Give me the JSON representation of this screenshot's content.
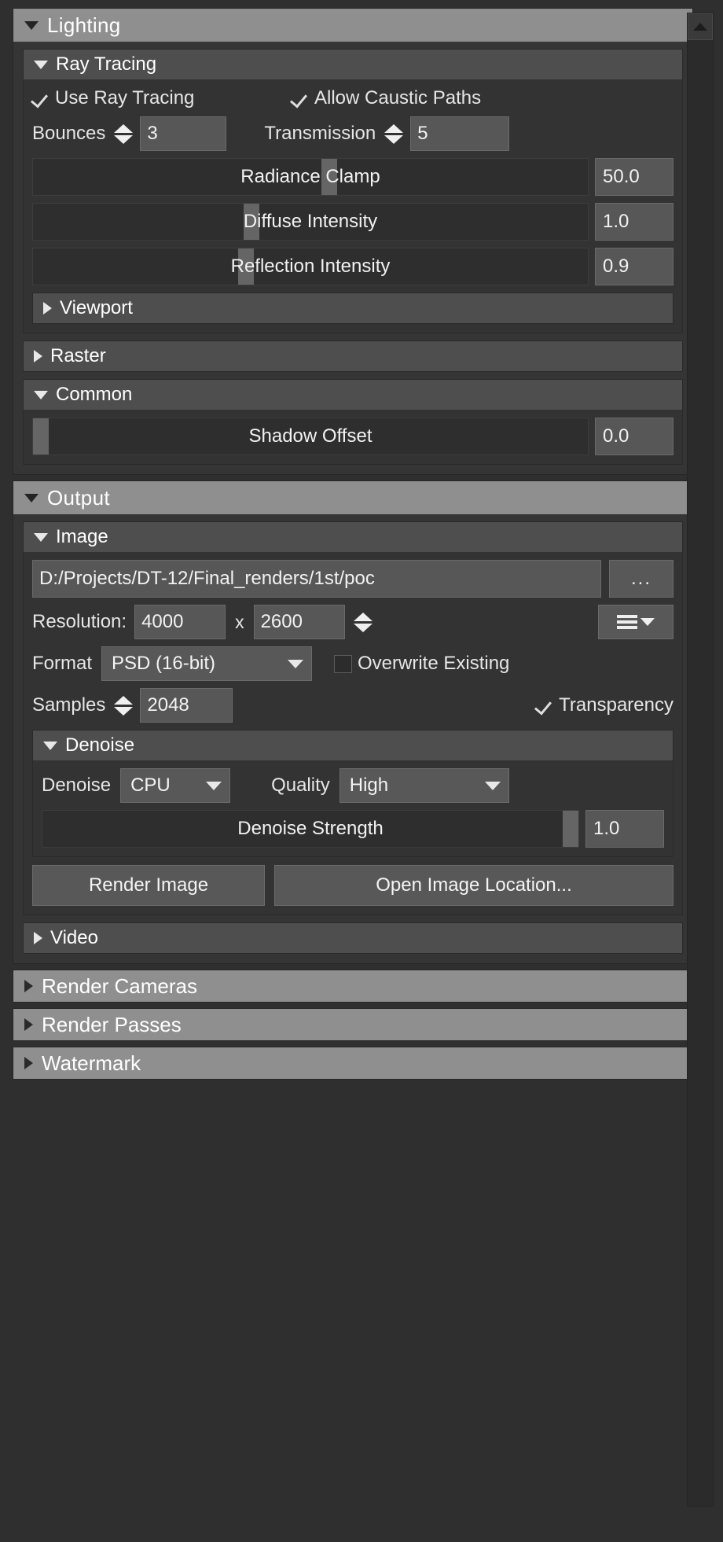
{
  "scrollbar": {
    "up_arrow_icon": "triangle-up-icon"
  },
  "lighting": {
    "title": "Lighting",
    "expanded_icon": "triangle-down-icon",
    "ray_tracing": {
      "title": "Ray Tracing",
      "expanded_icon": "triangle-down-icon",
      "use_ray_tracing": {
        "label": "Use Ray Tracing",
        "checked": true
      },
      "allow_caustic_paths": {
        "label": "Allow Caustic Paths",
        "checked": true
      },
      "bounces": {
        "label": "Bounces",
        "value": "3"
      },
      "transmission": {
        "label": "Transmission",
        "value": "5"
      },
      "sliders": [
        {
          "label": "Radiance Clamp",
          "value": "50.0",
          "handle_pct": 52
        },
        {
          "label": "Diffuse Intensity",
          "value": "1.0",
          "handle_pct": 38
        },
        {
          "label": "Reflection Intensity",
          "value": "0.9",
          "handle_pct": 37
        }
      ],
      "viewport": {
        "title": "Viewport",
        "collapsed_icon": "triangle-right-icon"
      }
    },
    "raster": {
      "title": "Raster",
      "collapsed_icon": "triangle-right-icon"
    },
    "common": {
      "title": "Common",
      "expanded_icon": "triangle-down-icon",
      "shadow_offset": {
        "label": "Shadow Offset",
        "value": "0.0",
        "handle_pct": 0
      }
    }
  },
  "output": {
    "title": "Output",
    "expanded_icon": "triangle-down-icon",
    "image": {
      "title": "Image",
      "expanded_icon": "triangle-down-icon",
      "path": {
        "value": "D:/Projects/DT-12/Final_renders/1st/poc",
        "placeholder": "Output path"
      },
      "browse_button": {
        "label": "...",
        "icon": "ellipsis-icon"
      },
      "resolution": {
        "label": "Resolution:",
        "width": "4000",
        "separator": "x",
        "height": "2600",
        "link_icon": "spinner-updown-icon",
        "preset_icon": "hamburger-menu-icon"
      },
      "format": {
        "label": "Format",
        "value": "PSD (16-bit)",
        "caret_icon": "triangle-down-icon"
      },
      "overwrite_existing": {
        "label": "Overwrite Existing",
        "checked": false
      },
      "samples": {
        "label": "Samples",
        "value": "2048",
        "spinner_icon": "spinner-updown-icon"
      },
      "transparency": {
        "label": "Transparency",
        "checked": true
      },
      "denoise_section": {
        "title": "Denoise",
        "expanded_icon": "triangle-down-icon",
        "denoise": {
          "label": "Denoise",
          "value": "CPU",
          "caret_icon": "triangle-down-icon"
        },
        "quality": {
          "label": "Quality",
          "value": "High",
          "caret_icon": "triangle-down-icon"
        },
        "strength": {
          "label": "Denoise Strength",
          "value": "1.0",
          "handle_pct": 98
        }
      },
      "render_image_button": {
        "label": "Render Image"
      },
      "open_location_button": {
        "label": "Open Image Location..."
      }
    },
    "video": {
      "title": "Video",
      "collapsed_icon": "triangle-right-icon"
    }
  },
  "bottom_sections": [
    {
      "title": "Render Cameras",
      "collapsed_icon": "triangle-right-icon"
    },
    {
      "title": "Render Passes",
      "collapsed_icon": "triangle-right-icon"
    },
    {
      "title": "Watermark",
      "collapsed_icon": "triangle-right-icon"
    }
  ]
}
